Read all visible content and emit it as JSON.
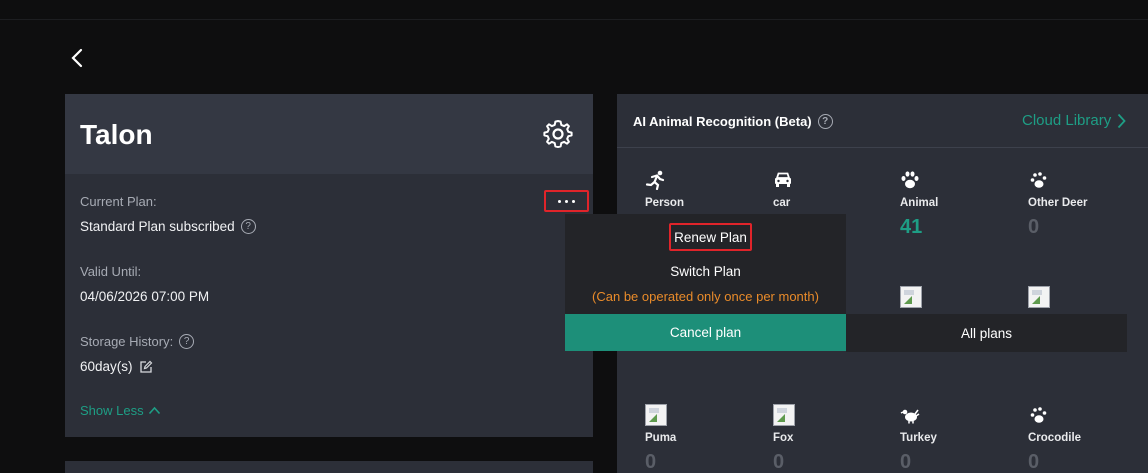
{
  "device": {
    "name": "Talon",
    "current_plan_label": "Current Plan:",
    "current_plan_value": "Standard Plan subscribed",
    "valid_until_label": "Valid Until:",
    "valid_until_value": "04/06/2026 07:00 PM",
    "storage_label": "Storage History:",
    "storage_value": "60day(s)",
    "show_less": "Show Less"
  },
  "ai": {
    "title": "AI Animal Recognition (Beta)",
    "cloud_link": "Cloud Library",
    "accent_color": "#1e9e85",
    "categories_row1": [
      {
        "name": "Person",
        "count": "",
        "icon": "person-running-icon"
      },
      {
        "name": "car",
        "count": "",
        "icon": "car-icon"
      },
      {
        "name": "Animal",
        "count": "41",
        "icon": "paw-icon"
      },
      {
        "name": "Other Deer",
        "count": "0",
        "icon": "paw-small-icon"
      }
    ],
    "categories_row3": [
      {
        "name": "Puma",
        "count": "0",
        "icon": "broken-image-icon"
      },
      {
        "name": "Fox",
        "count": "0",
        "icon": "broken-image-icon"
      },
      {
        "name": "Turkey",
        "count": "0",
        "icon": "turkey-icon"
      },
      {
        "name": "Crocodile",
        "count": "0",
        "icon": "paw-small-icon"
      }
    ]
  },
  "menu": {
    "renew": "Renew Plan",
    "switch": "Switch Plan",
    "switch_note": "(Can be operated only once per month)",
    "cancel": "Cancel plan",
    "all_plans": "All plans"
  }
}
